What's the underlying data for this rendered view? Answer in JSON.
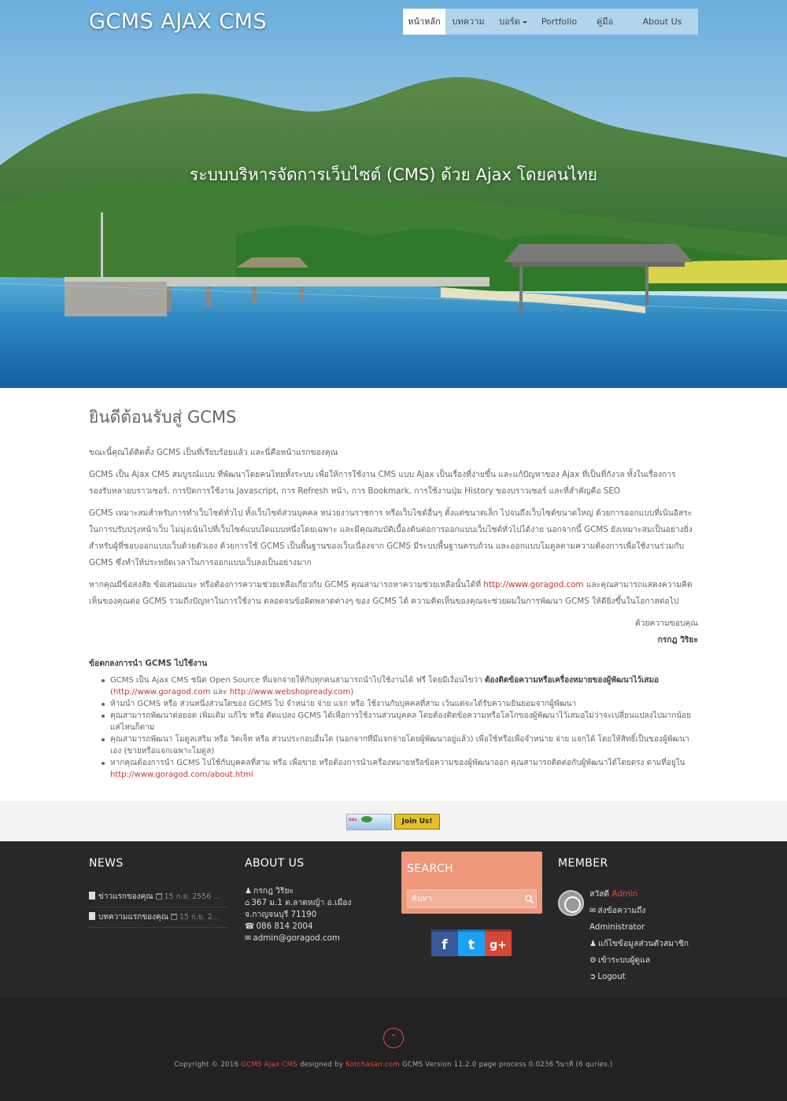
{
  "site": {
    "title": "GCMS AJAX CMS",
    "tagline": "ระบบบริหารจัดการเว็บไซต์ (CMS) ด้วย Ajax โดยคนไทย"
  },
  "nav": [
    {
      "label": "หน้าหลัก",
      "active": true
    },
    {
      "label": "บทความ"
    },
    {
      "label": "บอร์ด",
      "has_dropdown": true
    },
    {
      "label": "Portfolio"
    },
    {
      "label": "คู่มือ"
    },
    {
      "label": "About Us"
    }
  ],
  "content": {
    "heading": "ยินดีต้อนรับสู่ GCMS",
    "p1": "ขณะนี้คุณได้ติดตั้ง GCMS เป็นที่เรียบร้อยแล้ว และนี่คือหน้าแรกของคุณ",
    "p2": "GCMS เป็น Ajax CMS สมบูรณ์แบบ ที่พัฒนาโดยคนไทยทั้งระบบ เพื่อให้การใช้งาน CMS แบบ Ajax เป็นเรื่องที่ง่ายขึ้น และแก้ปัญหาของ Ajax ที่เป็นที่กังวล ทั้งในเรื่องการรองรับหลายบราวเซอร์, การปิดการใช้งาน Javascript, การ Refresh หน้า, การ Bookmark, การใช้งานปุ่ม History ของบราวเซอร์ และที่สำคัญคือ SEO",
    "p3": "GCMS เหมาะสมสำหรับการทำเว็บไซต์ทั่วไป ทั้งเว็บไซต์ส่วนบุคคล หน่วยงานราชการ หรือเว็บไซต์อื่นๆ ตั้งแต่ขนาดเล็ก ไปจนถึงเว็บไซต์ขนาดใหญ่ ด้วยการออกแบบที่เน้นอิสระในการปรับปรุงหน้าเว็บ ไม่มุ่งเน้นไปที่เว็บไซต์แบบใดแบบหนึ่งโดยเฉพาะ และมีคุณสมบัติเบื้องต้นต่อการออกแบบเว็บไซต์ทั่วไปได้ง่าย นอกจากนี้ GCMS ยังเหมาะสมเป็นอย่างยิ่ง สำหรับผู้ที่ชอบออกแบบเว็บด้วยตัวเอง ด้วยการใช้ GCMS เป็นพื้นฐานของเว็บเนื่องจาก GCMS มีระบบพื้นฐานครบถ้วน และออกแบบโมดูลตามความต้องการเพื่อใช้งานร่วมกับ GCMS ซึ่งทำให้ประหยัดเวลาในการออกแบบเว็บลงเป็นอย่างมาก",
    "p4_a": "หากคุณมีข้อสงสัย ข้อเสนอแนะ หรือต้องการความช่วยเหลือเกี่ยวกับ GCMS คุณสามารถหาความช่วยเหลือนั้นได้ที่ ",
    "p4_link": "http://www.goragod.com",
    "p4_b": " และคุณสามารถแสดงความคิดเห็นของคุณต่อ GCMS รวมถึงปัญหาในการใช้งาน ตลอดจนข้อผิดพลาดต่างๆ ของ GCMS ได้ ความคิดเห็นของคุณจะช่วยผมในการพัฒนา GCMS ให้ดียิ่งขึ้นในโอกาสต่อไป",
    "thanks": "ด้วยความขอบคุณ",
    "author": "กรกฎ วิริยะ",
    "terms_title": "ข้อตกลงการนำ GCMS ไปใช้งาน",
    "t1_a": "GCMS เป็น Ajax CMS ชนิด Open Source ที่แจกจ่ายให้กับทุกคนสามารถนำไปใช้งานได้ ฟรี โดยมีเงื่อนไขว่า ",
    "t1_bold": "ต้องติดข้อความหรือเครื่องหมายของผู้พัฒนาไว้เสมอ",
    "t1_b": " (",
    "t1_link1": "http://www.goragod.com",
    "t1_and": " และ ",
    "t1_link2": "http://www.webshopready.com",
    "t1_end": ")",
    "t2": "ห้ามนำ GCMS หรือ ส่วนหนึ่งส่วนใดของ GCMS ไป จำหน่าย จ่าย แจก หรือ ใช้งานกับบุคคลที่สาม เว้นแต่จะได้รับความยินยอมจากผู้พัฒนา",
    "t3": "คุณสามารถพัฒนาต่อยอด เพิ่มเติม แก้ไข หรือ ดัดแปลง GCMS ได้เพื่อการใช้งานส่วนบุคคล โดยต้องติดข้อความหรือโลโกของผู้พัฒนาไว้เสมอไม่ว่าจะเปลี่ยนแปลงไปมากน้อยแค่ไหนก็ตาม",
    "t4": "คุณสามารถพัฒนา โมดูลเสริม หรือ วิดเจ็ท หรือ ส่วนประกอบอื่นใด (นอกจากที่มีแจกจ่ายโดยผู้พัฒนาอยู่แล้ว) เพื่อใช้หรือเพื่อจำหน่าย จ่าย แจกได้ โดยให้สิทธิ์เป็นของผู้พัฒนาเอง (ขายหรือแจกเฉพาะโมดูล)",
    "t5_a": "หากคุณต้องการนำ GCMS ไปใช้กับบุคคลที่สาม หรือ เพื่อขาย หรือต้องการนำเครื่องหมายหรือข้อความของผู้พัฒนาออก คุณสามารถติดต่อกับผู้พัฒนาได้โดยตรง ตามที่อยู่ใน ",
    "t5_link": "http://www.goragod.com/about.html"
  },
  "banners": {
    "b1": "ถอง",
    "b2": "Join Us!"
  },
  "footer": {
    "news": {
      "title": "NEWS",
      "items": [
        {
          "title": "ข่าวแรกของคุณ",
          "date": "15 ก.ย. 2556 ..."
        },
        {
          "title": "บทความแรกของคุณ",
          "date": "15 ก.ย. 2..."
        }
      ]
    },
    "about": {
      "title": "ABOUT US",
      "name": "กรกฎ วิริยะ",
      "address1": "367 ม.1 ต.ลาดหญ้า อ.เมือง",
      "address2": "จ.กาญจนบุรี 71190",
      "phone": "086 814 2004",
      "email": "admin@goragod.com"
    },
    "search": {
      "title": "SEARCH",
      "placeholder": "ค้นหา"
    },
    "social": {
      "facebook": "f",
      "twitter": "t",
      "google": "g+"
    },
    "member": {
      "title": "MEMBER",
      "greeting": "สวัสดี",
      "username": "Admin",
      "send_message": "ส่งข้อความถึง",
      "role": "Administrator",
      "edit_profile": "แก้ไขข้อมูลส่วนตัวสมาชิก",
      "admin_login": "เข้าระบบผู้ดูแล",
      "logout": "Logout"
    },
    "copyright_a": "Copyright © 2016 ",
    "copyright_link1": "GCMS Ajax CMS",
    "copyright_b": " designed by ",
    "copyright_link2": "Kotchasan.com",
    "copyright_c": " GCMS Version 11.2.0 page process 0.0236 วินาที (6 quries.)"
  },
  "colors": {
    "accent": "#e74c3c",
    "footer_bg": "#282828",
    "search_bg": "#ee977b"
  }
}
